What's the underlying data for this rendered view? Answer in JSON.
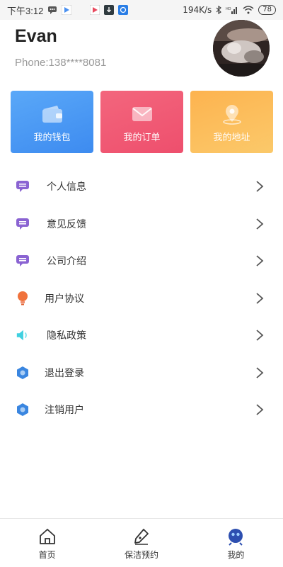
{
  "status_bar": {
    "time": "下午3:12",
    "speed": "194K/s",
    "battery": "78",
    "colors": {
      "play": "#4a90f0",
      "download": "#2f3a3f",
      "blue_app": "#2a7ee6"
    }
  },
  "profile": {
    "name": "Evan",
    "phone": "Phone:138****8081"
  },
  "cards": [
    {
      "label": "我的钱包",
      "icon": "wallet-icon",
      "color": "#4a9af5"
    },
    {
      "label": "我的订单",
      "icon": "mail-icon",
      "color": "#f05a75"
    },
    {
      "label": "我的地址",
      "icon": "location-pin-icon",
      "color": "#fcbc5c"
    }
  ],
  "menu": [
    {
      "label": "个人信息",
      "icon": "message-icon",
      "icon_color": "#8a63d2"
    },
    {
      "label": "意见反馈",
      "icon": "message-icon",
      "icon_color": "#8a63d2"
    },
    {
      "label": "公司介绍",
      "icon": "message-icon",
      "icon_color": "#8a63d2"
    },
    {
      "label": "用户协议",
      "icon": "lightbulb-icon",
      "icon_color": "#f0723c"
    },
    {
      "label": "隐私政策",
      "icon": "speaker-icon",
      "icon_color": "#3fd0e0"
    },
    {
      "label": "退出登录",
      "icon": "hexagon-icon",
      "icon_color": "#3a86e0"
    },
    {
      "label": "注销用户",
      "icon": "hexagon-icon",
      "icon_color": "#3a86e0"
    }
  ],
  "bottom_nav": [
    {
      "label": "首页",
      "icon": "home-icon"
    },
    {
      "label": "保洁预约",
      "icon": "pen-icon"
    },
    {
      "label": "我的",
      "icon": "profile-icon",
      "active": true
    }
  ]
}
